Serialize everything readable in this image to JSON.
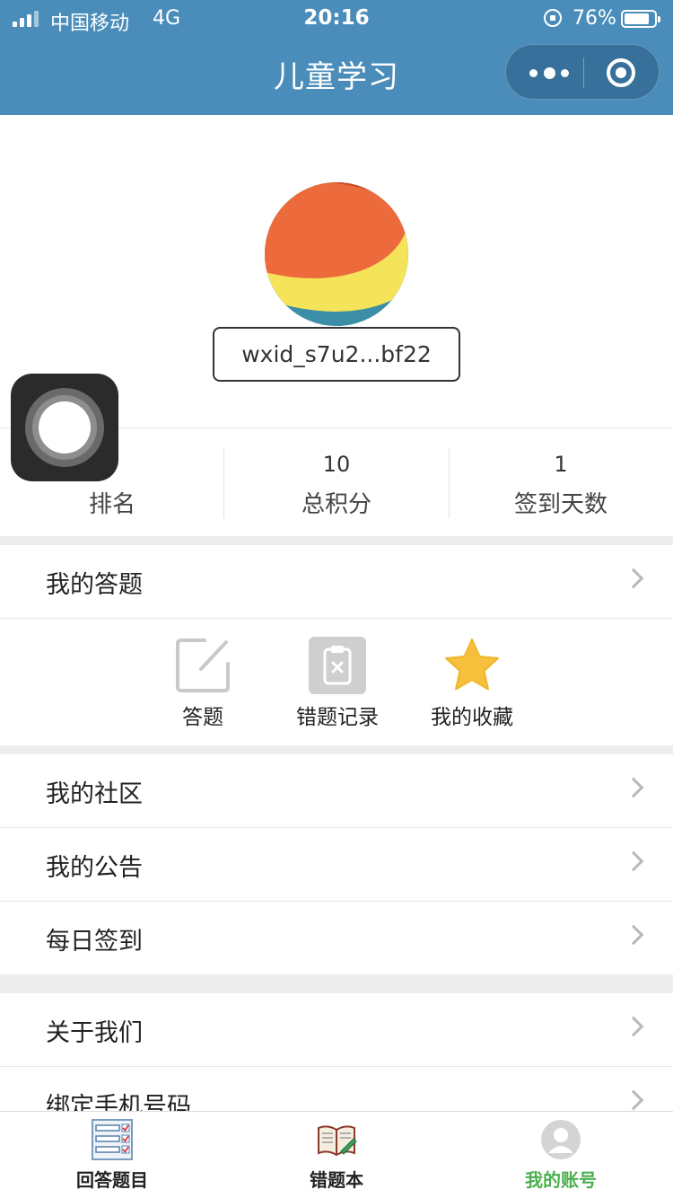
{
  "status_bar": {
    "carrier": "中国移动",
    "network": "4G",
    "time": "20:16",
    "battery_pct": "76%"
  },
  "nav": {
    "title": "儿童学习"
  },
  "profile": {
    "username": "wxid_s7u2...bf22"
  },
  "stats": [
    {
      "value": "",
      "label": "排名"
    },
    {
      "value": "10",
      "label": "总积分"
    },
    {
      "value": "1",
      "label": "签到天数"
    }
  ],
  "menu": {
    "my_answers": "我的答题",
    "my_community": "我的社区",
    "my_notices": "我的公告",
    "daily_checkin": "每日签到",
    "about_us": "关于我们",
    "bind_phone": "绑定手机号码"
  },
  "quick_actions": [
    {
      "label": "答题",
      "icon": "edit-icon"
    },
    {
      "label": "错题记录",
      "icon": "clipboard-x-icon"
    },
    {
      "label": "我的收藏",
      "icon": "star-icon"
    }
  ],
  "tabbar": [
    {
      "label": "回答题目",
      "icon": "checklist-icon"
    },
    {
      "label": "错题本",
      "icon": "book-icon"
    },
    {
      "label": "我的账号",
      "icon": "user-icon",
      "active": true
    }
  ],
  "colors": {
    "nav_bg": "#4a8dba",
    "active_tab": "#4caf50",
    "star": "#f7c03c",
    "section_gap": "#ededed"
  }
}
